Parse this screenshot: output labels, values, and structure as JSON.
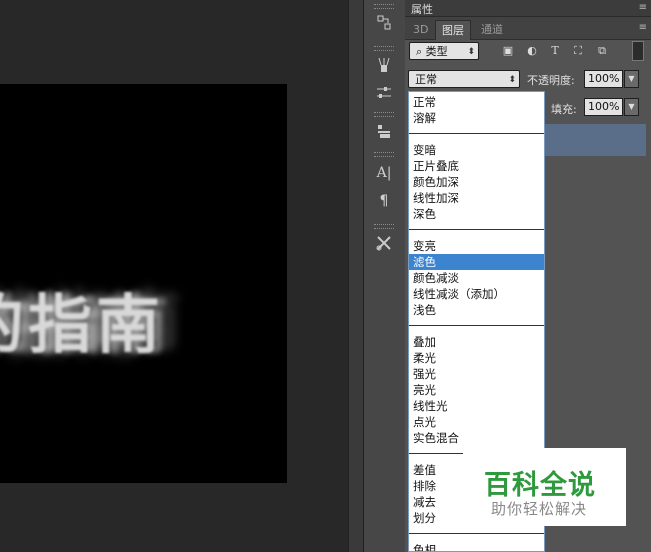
{
  "canvas": {
    "text": "的指南"
  },
  "panel": {
    "properties_tab": "属性",
    "tabs": [
      "3D",
      "图层",
      "通道"
    ],
    "filter": {
      "label": "类型"
    },
    "blend_mode": {
      "value": "正常"
    },
    "opacity": {
      "label": "不透明度:",
      "value": "100%"
    },
    "fill": {
      "label": "填充:",
      "value": "100%"
    }
  },
  "blend_modes": {
    "groups": [
      [
        "正常",
        "溶解"
      ],
      [
        "变暗",
        "正片叠底",
        "颜色加深",
        "线性加深",
        "深色"
      ],
      [
        "变亮",
        "滤色",
        "颜色减淡",
        "线性减淡（添加）",
        "浅色"
      ],
      [
        "叠加",
        "柔光",
        "强光",
        "亮光",
        "线性光",
        "点光",
        "实色混合"
      ],
      [
        "差值",
        "排除",
        "减去",
        "划分"
      ],
      [
        "色相"
      ]
    ],
    "selected": "滤色"
  },
  "watermark": {
    "title": "百科全说",
    "subtitle": "助你轻松解决"
  },
  "colors": {
    "selected": "#3c84d0",
    "layer_highlight": "#5a6e8a",
    "watermark_green": "#2e9a3d"
  }
}
